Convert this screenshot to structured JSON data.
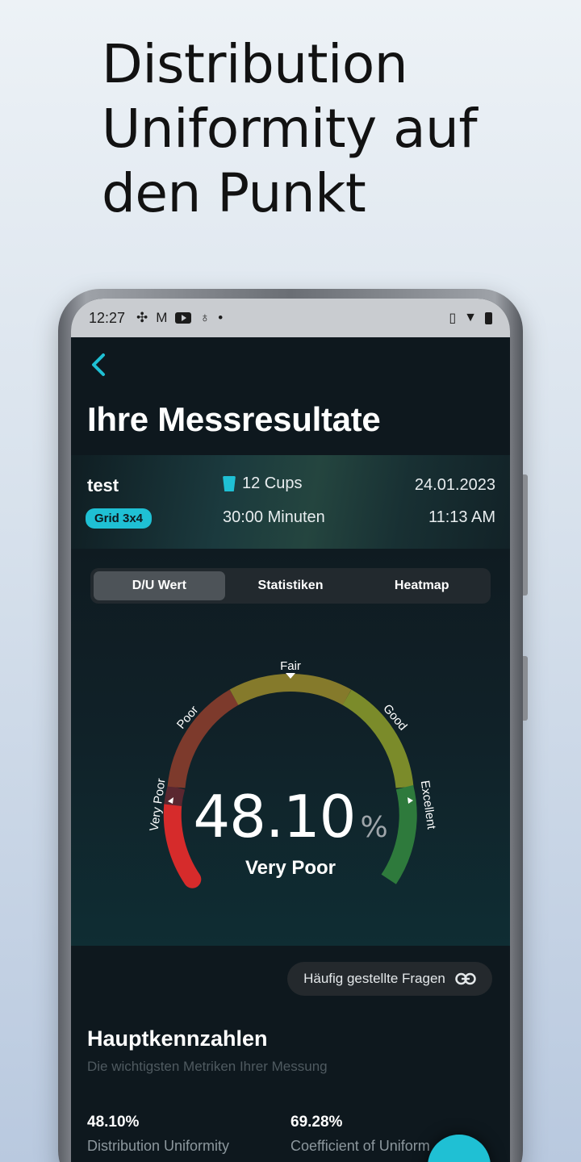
{
  "headline": [
    "Distribution",
    "Uniformity auf",
    "den Punkt"
  ],
  "statusbar": {
    "time": "12:27"
  },
  "header": {
    "title": "Ihre Messresultate"
  },
  "info": {
    "name": "test",
    "grid_badge": "Grid 3x4",
    "cups": "12 Cups",
    "duration": "30:00 Minuten",
    "date": "24.01.2023",
    "time": "11:13 AM"
  },
  "tabs": [
    {
      "label": "D/U Wert",
      "active": true
    },
    {
      "label": "Statistiken",
      "active": false
    },
    {
      "label": "Heatmap",
      "active": false
    }
  ],
  "gauge": {
    "value": "48.10",
    "unit": "%",
    "rating": "Very Poor",
    "labels": {
      "very_poor": "Very Poor",
      "poor": "Poor",
      "fair": "Fair",
      "good": "Good",
      "excellent": "Excellent"
    },
    "colors": {
      "red": "#d62b2b",
      "darkred": "#8a2d2d",
      "brown": "#8b4a2f",
      "olive": "#8a7a2c",
      "yellowgreen": "#7a8c2a",
      "green": "#2f7a3e"
    }
  },
  "faq": {
    "label": "Häufig gestellte Fragen"
  },
  "kpi": {
    "title": "Hauptkennzahlen",
    "subtitle": "Die wichtigsten Metriken Ihrer Messung",
    "items": [
      {
        "value": "48.10%",
        "label": "Distribution Uniformity"
      },
      {
        "value": "69.28%",
        "label": "Coefficient of Uniform"
      }
    ]
  },
  "accent": "#1fc0d4"
}
